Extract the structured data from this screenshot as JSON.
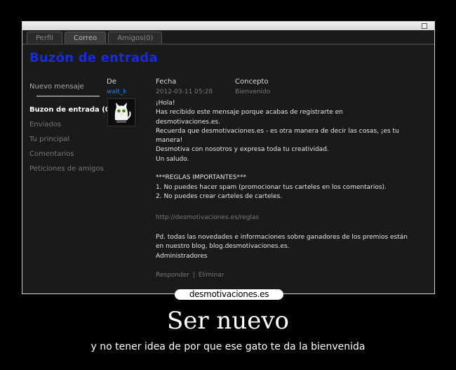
{
  "tabs": [
    "Perfil",
    "Correo",
    "Amigos(0)"
  ],
  "page_title": "Buzón de entrada",
  "sidebar": {
    "items": [
      "Nuevo mensaje",
      "Buzon de entrada (0)",
      "Enviados",
      "Tu principal",
      "Comentarios",
      "Peticiones de amigos"
    ]
  },
  "columns": {
    "from": "De",
    "date": "Fecha",
    "subject": "Concepto"
  },
  "message": {
    "sender": "walt_k",
    "date": "2012-03-11 05:28",
    "subject": "Bienvenido",
    "body": "¡Hola!\nHas recibido este mensaje porque acabas de registrarte en\ndesmotivaciones.es.\nRecuerda que desmotivaciones.es - es otra manera de decir las cosas, ¡es tu\nmanera!\nDesmotiva con nosotros y expresa toda tu creatividad.\nUn saludo.\n\n***REGLAS IMPORTANTES***\n1. No puedes hacer spam (promocionar tus carteles en los comentarios).\n2. No puedes crear carteles de carteles.",
    "url": "http://desmotivaciones.es/reglas",
    "postscript": "Pd. todas las novedades e informaciones sobre ganadores de los premios están\nen nuestro blog, blog.desmotivaciones.es.\nAdministradores",
    "reply": "Responder",
    "separator": "|",
    "delete": "Eliminar"
  },
  "watermark": "desmotivaciones.es",
  "poster": {
    "title": "Ser nuevo",
    "caption": "y no tener idea de  por que ese gato te da la bienvenida"
  }
}
